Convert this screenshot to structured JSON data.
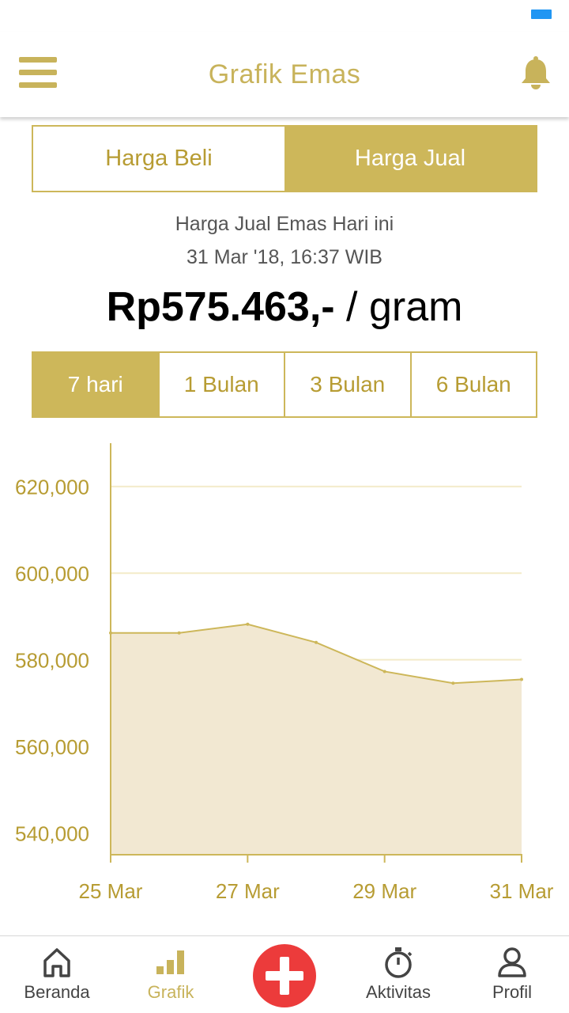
{
  "header": {
    "title": "Grafik Emas",
    "menu_icon": "hamburger-menu-icon",
    "notification_icon": "bell-icon"
  },
  "price_type_toggle": [
    {
      "label": "Harga Beli",
      "active": false
    },
    {
      "label": "Harga Jual",
      "active": true
    }
  ],
  "info": {
    "heading": "Harga Jual Emas Hari ini",
    "timestamp": "31 Mar '18, 16:37 WIB",
    "price": "Rp575.463,-",
    "unit": " / gram"
  },
  "period_tabs": [
    {
      "label": "7 hari",
      "active": true
    },
    {
      "label": "1 Bulan",
      "active": false
    },
    {
      "label": "3 Bulan",
      "active": false
    },
    {
      "label": "6 Bulan",
      "active": false
    }
  ],
  "chart_data": {
    "type": "area",
    "x": [
      "25 Mar",
      "26 Mar",
      "27 Mar",
      "28 Mar",
      "29 Mar",
      "30 Mar",
      "31 Mar"
    ],
    "values": [
      586200,
      586200,
      588200,
      584000,
      577300,
      574600,
      575463
    ],
    "x_tick_labels": [
      "25 Mar",
      "27 Mar",
      "29 Mar",
      "31 Mar"
    ],
    "y_tick_values": [
      540000,
      560000,
      580000,
      600000,
      620000
    ],
    "y_tick_labels": [
      "540,000",
      "560,000",
      "580,000",
      "600,000",
      "620,000"
    ],
    "ylim": [
      535000,
      630000
    ],
    "grid": true,
    "colors": {
      "line": "#CDB75A",
      "fill": "#F2E8D2",
      "grid": "#F3EBC9",
      "axis": "#CDB75A",
      "tick_text": "#B79C33"
    }
  },
  "bottom_nav": {
    "items": [
      {
        "label": "Beranda",
        "icon": "home-icon",
        "active": false
      },
      {
        "label": "Grafik",
        "icon": "bar-chart-icon",
        "active": true
      },
      {
        "label": "Aktivitas",
        "icon": "stopwatch-icon",
        "active": false
      },
      {
        "label": "Profil",
        "icon": "person-icon",
        "active": false
      }
    ],
    "fab_icon": "plus-icon"
  },
  "colors": {
    "accent": "#CDB75A",
    "accent_text": "#B79C33",
    "fab": "#EC3B3B",
    "status_indicator": "#2196F3"
  }
}
